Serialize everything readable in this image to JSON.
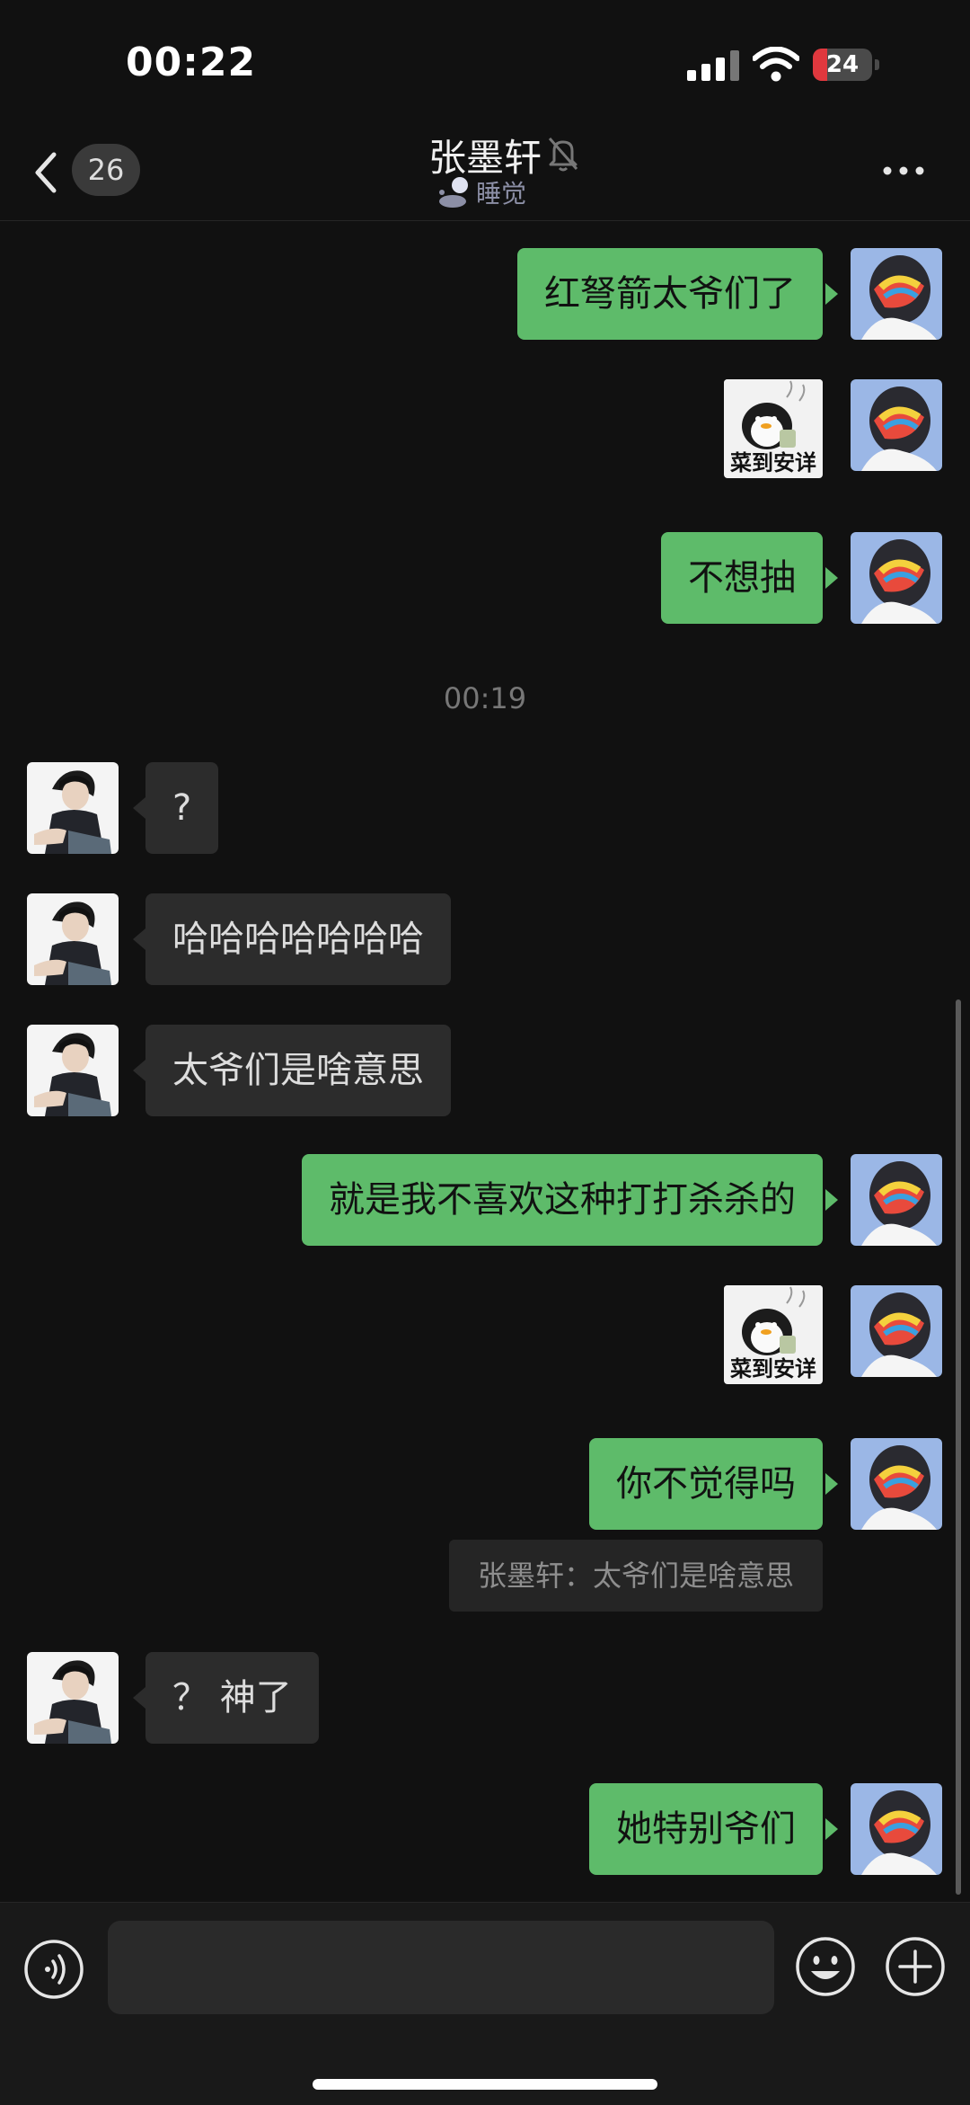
{
  "status_bar": {
    "time": "00:22",
    "battery": "24",
    "battery_level": 0.24,
    "battery_color": "#e0383e"
  },
  "nav": {
    "unread_count": "26",
    "contact_name": "张墨轩",
    "status_text": "睡觉",
    "icons": [
      "chevron-left-icon",
      "bell-muted-icon",
      "sleep-status-icon",
      "more-icon"
    ]
  },
  "messages": [
    {
      "side": "me",
      "type": "text",
      "text": "红弩箭太爷们了"
    },
    {
      "side": "me",
      "type": "sticker",
      "caption": "菜到安详"
    },
    {
      "side": "me",
      "type": "text",
      "text": "不想抽"
    },
    {
      "type": "time",
      "text": "00:19"
    },
    {
      "side": "them",
      "type": "text",
      "text": "?"
    },
    {
      "side": "them",
      "type": "text",
      "text": "哈哈哈哈哈哈哈"
    },
    {
      "side": "them",
      "type": "text",
      "text": "太爷们是啥意思"
    },
    {
      "side": "me",
      "type": "text",
      "text": "就是我不喜欢这种打打杀杀的"
    },
    {
      "side": "me",
      "type": "sticker",
      "caption": "菜到安详"
    },
    {
      "side": "me",
      "type": "text",
      "text": "你不觉得吗"
    },
    {
      "type": "quote",
      "text": "张墨轩：太爷们是啥意思"
    },
    {
      "side": "them",
      "type": "text",
      "text": "？ 神了"
    },
    {
      "side": "me",
      "type": "text",
      "text": "她特别爷们"
    }
  ],
  "input_bar": {
    "placeholder": "",
    "icons": [
      "voice-icon",
      "emoji-icon",
      "plus-icon"
    ]
  },
  "colors": {
    "background": "#111111",
    "my_bubble": "#5ebb6a",
    "their_bubble": "#2c2c2c",
    "quote_bg": "#252525"
  }
}
